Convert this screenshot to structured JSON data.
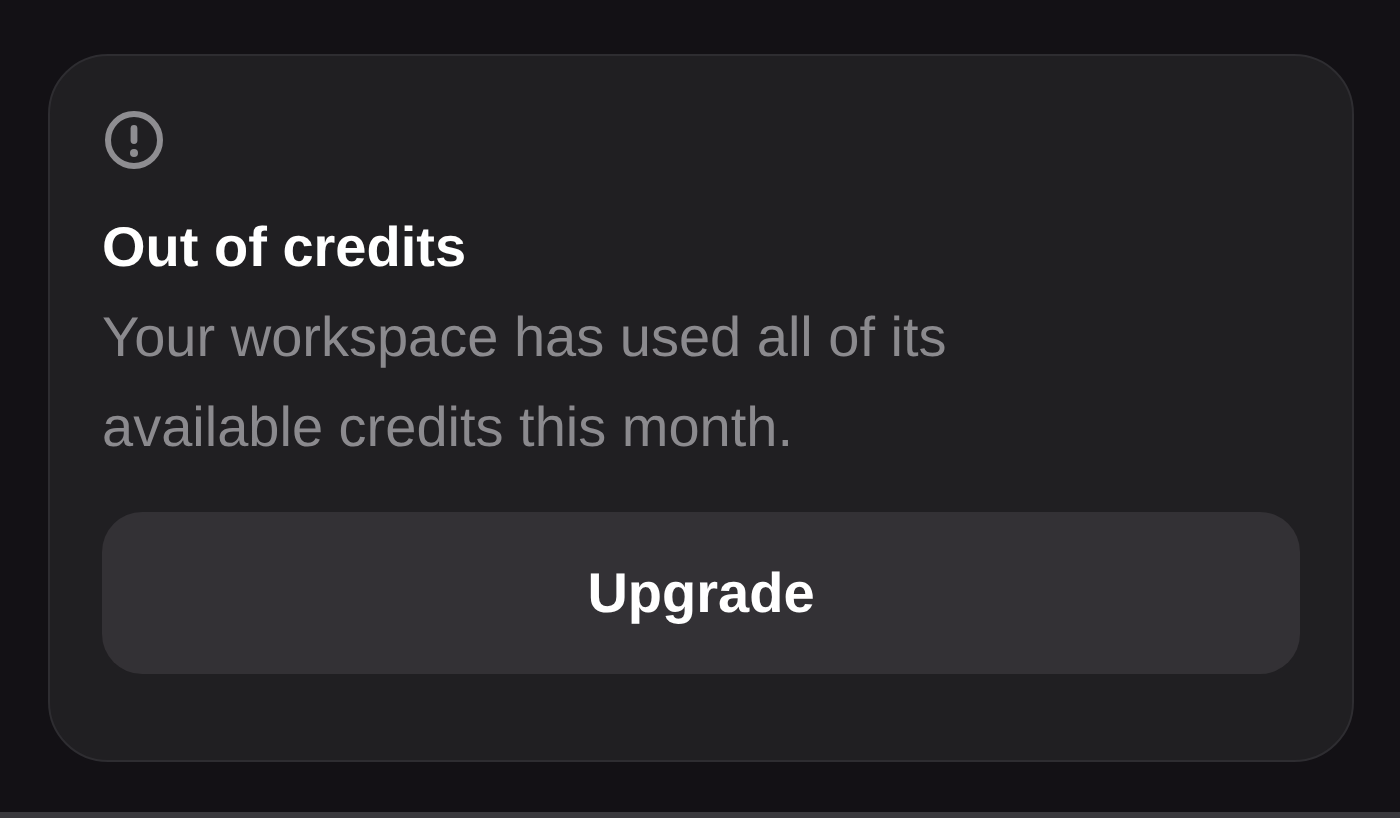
{
  "alert": {
    "title": "Out of credits",
    "description": "Your workspace has used all of its available credits this month.",
    "button": "Upgrade"
  }
}
